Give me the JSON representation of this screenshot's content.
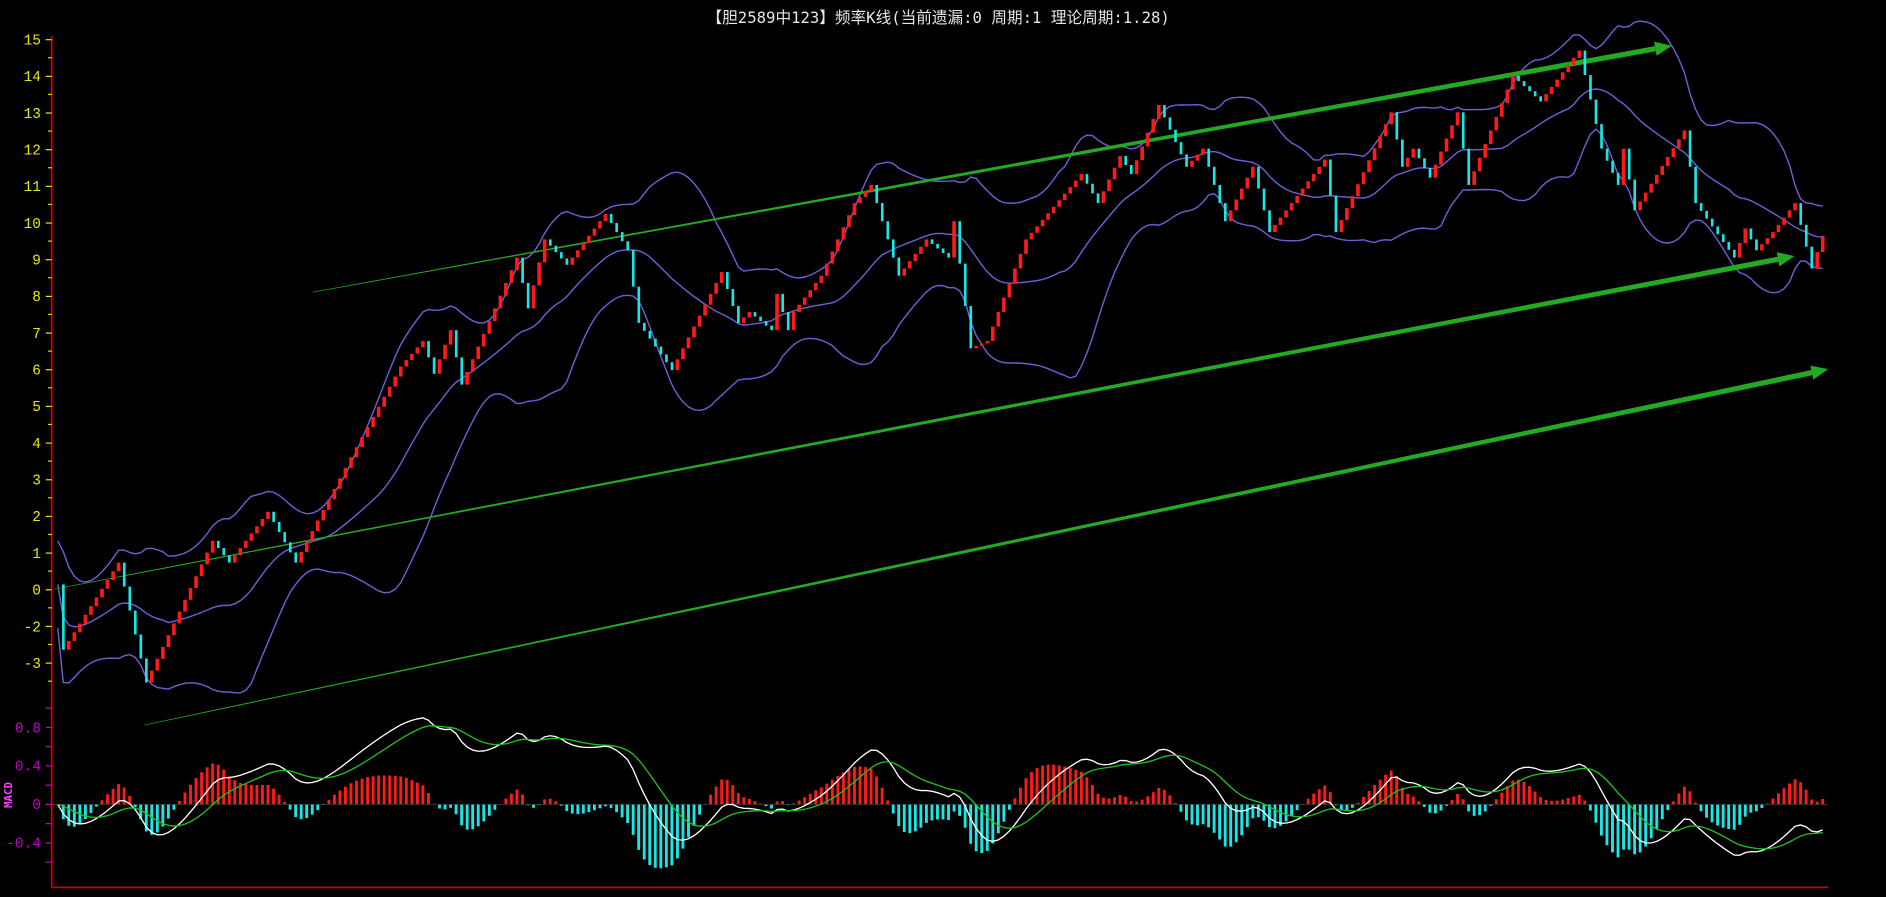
{
  "chart_data": {
    "type": "candlestick",
    "title": "【胆2589中123】频率K线(当前遗漏:0 周期:1 理论周期:1.28)",
    "main_y_tick_labels": [
      "15",
      "14",
      "13",
      "12",
      "11",
      "10",
      "9",
      "8",
      "7",
      "6",
      "5",
      "4",
      "3",
      "2",
      "1",
      "0",
      "-2",
      "-3"
    ],
    "indicator_name": "MACD",
    "macd_y_tick_labels": [
      "0.8",
      "0.4",
      "0",
      "-0.4"
    ],
    "macd_tick_values": [
      0.8,
      0.4,
      0,
      -0.4
    ],
    "macd_range": [
      -0.85,
      1.0
    ],
    "ylim": [
      -3.5,
      15
    ],
    "bollinger": {
      "period": 20,
      "k": 2
    },
    "macd_params": {
      "short": 12,
      "long": 26,
      "signal": 9
    },
    "keypoints": [
      {
        "t": 0,
        "v": 0
      },
      {
        "t": 1,
        "v": -1.8
      },
      {
        "t": 11,
        "v": 0.6
      },
      {
        "t": 16,
        "v": -2.7
      },
      {
        "t": 28,
        "v": 1.2
      },
      {
        "t": 31,
        "v": 0.6
      },
      {
        "t": 38,
        "v": 2.0
      },
      {
        "t": 43,
        "v": 0.6
      },
      {
        "t": 53,
        "v": 3.5
      },
      {
        "t": 62,
        "v": 6.0
      },
      {
        "t": 66,
        "v": 6.7
      },
      {
        "t": 68,
        "v": 5.8
      },
      {
        "t": 71,
        "v": 7.0
      },
      {
        "t": 73,
        "v": 5.5
      },
      {
        "t": 83,
        "v": 9.0
      },
      {
        "t": 85,
        "v": 7.6
      },
      {
        "t": 88,
        "v": 9.5
      },
      {
        "t": 92,
        "v": 8.8
      },
      {
        "t": 99,
        "v": 10.2
      },
      {
        "t": 103,
        "v": 9.2
      },
      {
        "t": 105,
        "v": 7.2
      },
      {
        "t": 111,
        "v": 5.9
      },
      {
        "t": 120,
        "v": 8.6
      },
      {
        "t": 123,
        "v": 7.2
      },
      {
        "t": 125,
        "v": 7.5
      },
      {
        "t": 129,
        "v": 7.0
      },
      {
        "t": 130,
        "v": 8.0
      },
      {
        "t": 132,
        "v": 7.0
      },
      {
        "t": 133,
        "v": 7.5
      },
      {
        "t": 138,
        "v": 8.5
      },
      {
        "t": 144,
        "v": 10.5
      },
      {
        "t": 147,
        "v": 11.0
      },
      {
        "t": 152,
        "v": 8.5
      },
      {
        "t": 157,
        "v": 9.5
      },
      {
        "t": 161,
        "v": 9.0
      },
      {
        "t": 162,
        "v": 10.0
      },
      {
        "t": 165,
        "v": 6.5
      },
      {
        "t": 168,
        "v": 6.7
      },
      {
        "t": 175,
        "v": 9.5
      },
      {
        "t": 185,
        "v": 11.3
      },
      {
        "t": 188,
        "v": 10.5
      },
      {
        "t": 192,
        "v": 11.8
      },
      {
        "t": 194,
        "v": 11.3
      },
      {
        "t": 199,
        "v": 13.2
      },
      {
        "t": 204,
        "v": 11.5
      },
      {
        "t": 207,
        "v": 12.0
      },
      {
        "t": 211,
        "v": 10.0
      },
      {
        "t": 216,
        "v": 11.5
      },
      {
        "t": 219,
        "v": 9.7
      },
      {
        "t": 229,
        "v": 11.7
      },
      {
        "t": 231,
        "v": 9.7
      },
      {
        "t": 241,
        "v": 13.0
      },
      {
        "t": 243,
        "v": 11.5
      },
      {
        "t": 245,
        "v": 12.0
      },
      {
        "t": 248,
        "v": 11.2
      },
      {
        "t": 253,
        "v": 13.0
      },
      {
        "t": 255,
        "v": 11.0
      },
      {
        "t": 263,
        "v": 14.0
      },
      {
        "t": 268,
        "v": 13.3
      },
      {
        "t": 275,
        "v": 14.7
      },
      {
        "t": 279,
        "v": 12.0
      },
      {
        "t": 282,
        "v": 11.0
      },
      {
        "t": 283,
        "v": 12.0
      },
      {
        "t": 285,
        "v": 10.3
      },
      {
        "t": 294,
        "v": 12.5
      },
      {
        "t": 296,
        "v": 10.5
      },
      {
        "t": 303,
        "v": 9.0
      },
      {
        "t": 305,
        "v": 9.8
      },
      {
        "t": 307,
        "v": 9.2
      },
      {
        "t": 310,
        "v": 9.7
      },
      {
        "t": 314,
        "v": 10.5
      },
      {
        "t": 317,
        "v": 8.7
      },
      {
        "t": 319,
        "v": 9.6
      }
    ],
    "colors": {
      "up": "#ff1a1a",
      "down": "#19e6e6",
      "band": "#6a5fd0",
      "dif": "#ffffff",
      "dea": "#20c020",
      "trend": "#22aa22",
      "axis": "#cc0000",
      "tick": "#e8e800",
      "macd_tick": "#c000c0"
    }
  }
}
